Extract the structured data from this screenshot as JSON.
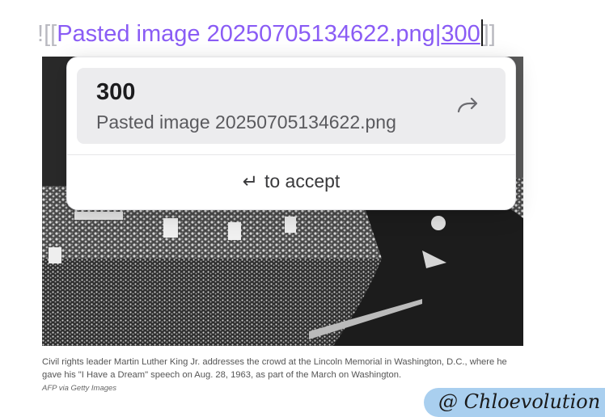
{
  "editor": {
    "bang": "!",
    "open_brackets": "[[",
    "link_target": "Pasted image 20250705134622.png",
    "pipe": "|",
    "alias": "300",
    "close_brackets": "]]"
  },
  "photo": {
    "caption": "Civil rights leader Martin Luther King Jr. addresses the crowd at the Lincoln Memorial in Washington, D.C., where he gave his \"I Have a Dream\" speech on Aug. 28, 1963, as part of the March on Washington.",
    "credit": "AFP via Getty Images"
  },
  "popup": {
    "suggestion_title": "300",
    "suggestion_subtitle": "Pasted image 20250705134622.png",
    "suggestion_icon": "redirect-arrow-icon",
    "hint_glyph": "↵",
    "hint_text": "to accept"
  },
  "watermark": {
    "text": "@ Chloevolution",
    "color": "#a9cfef"
  },
  "colors": {
    "link": "#8a5cf5",
    "bracket": "#b9b9c0",
    "suggestion_bg": "#ececee"
  }
}
